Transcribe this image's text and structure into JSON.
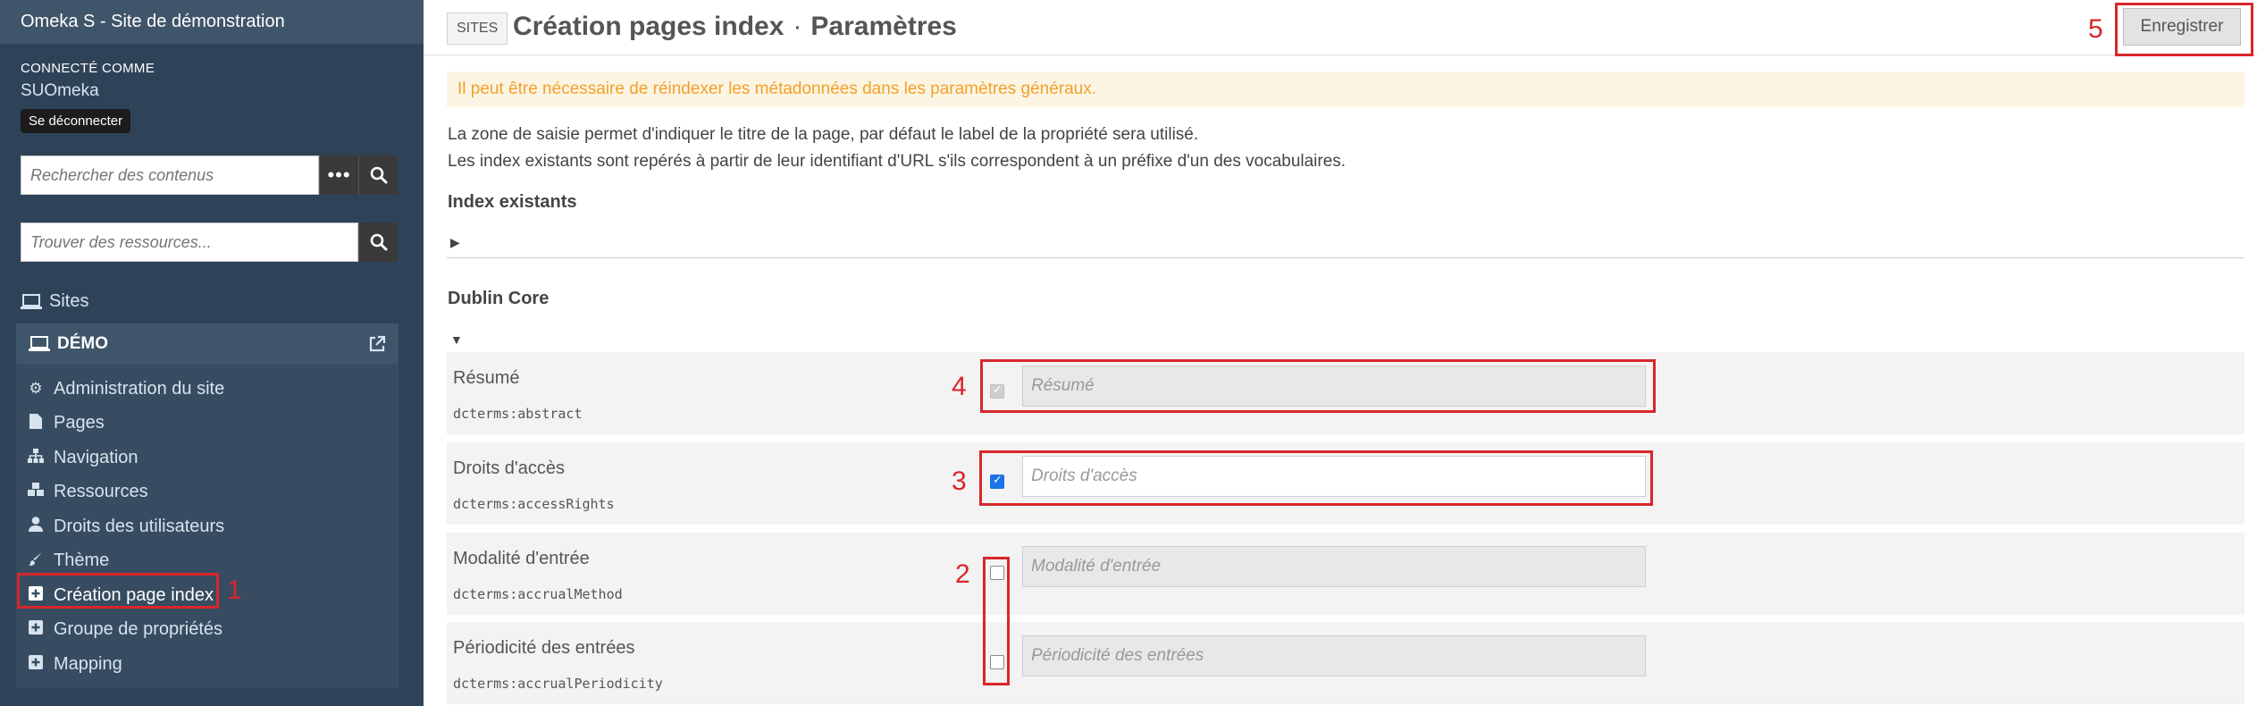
{
  "app": {
    "title": "Omeka S - Site de démonstration"
  },
  "user": {
    "caption": "CONNECTÉ COMME",
    "name": "SUOmeka",
    "logout_label": "Se déconnecter"
  },
  "search": {
    "content_placeholder": "Rechercher des contenus",
    "resource_placeholder": "Trouver des ressources..."
  },
  "nav": {
    "sites_label": "Sites",
    "site_name": "DÉMO",
    "items": [
      {
        "label": "Administration du site",
        "icon": "gears-icon"
      },
      {
        "label": "Pages",
        "icon": "file-icon"
      },
      {
        "label": "Navigation",
        "icon": "sitemap-icon"
      },
      {
        "label": "Ressources",
        "icon": "cubes-icon"
      },
      {
        "label": "Droits des utilisateurs",
        "icon": "user-icon"
      },
      {
        "label": "Thème",
        "icon": "brush-icon"
      },
      {
        "label": "Création page index",
        "icon": "plus-square-icon",
        "active": true
      },
      {
        "label": "Groupe de propriétés",
        "icon": "plus-square-icon"
      },
      {
        "label": "Mapping",
        "icon": "plus-square-icon"
      }
    ]
  },
  "header": {
    "breadcrumb": "SITES",
    "title": "Création pages index",
    "subtitle": "Paramètres",
    "save_label": "Enregistrer"
  },
  "alert": "Il peut être nécessaire de réindexer les métadonnées dans les paramètres généraux.",
  "description": {
    "line1": "La zone de saisie permet d'indiquer le titre de la page, par défaut le label de la propriété sera utilisé.",
    "line2": "Les index existants sont repérés à partir de leur identifiant d'URL s'ils correspondent à un préfixe d'un des vocabulaires."
  },
  "sections": {
    "existing": "Index existants",
    "dublin": "Dublin Core"
  },
  "fields": [
    {
      "label": "Résumé",
      "term": "dcterms:abstract",
      "placeholder": "Résumé",
      "checked": true,
      "disabled": true
    },
    {
      "label": "Droits d'accès",
      "term": "dcterms:accessRights",
      "placeholder": "Droits d'accès",
      "checked": true,
      "disabled": false
    },
    {
      "label": "Modalité d'entrée",
      "term": "dcterms:accrualMethod",
      "placeholder": "Modalité d'entrée",
      "checked": false,
      "disabled": false
    },
    {
      "label": "Périodicité des entrées",
      "term": "dcterms:accrualPeriodicity",
      "placeholder": "Périodicité des entrées",
      "checked": false,
      "disabled": false
    }
  ],
  "annotations": {
    "n1": "1",
    "n2": "2",
    "n3": "3",
    "n4": "4",
    "n5": "5"
  },
  "colors": {
    "sidebar": "#2f4358",
    "annotation": "#d8262c",
    "alert_text": "#f2a02a",
    "checkbox": "#1a73e8"
  }
}
